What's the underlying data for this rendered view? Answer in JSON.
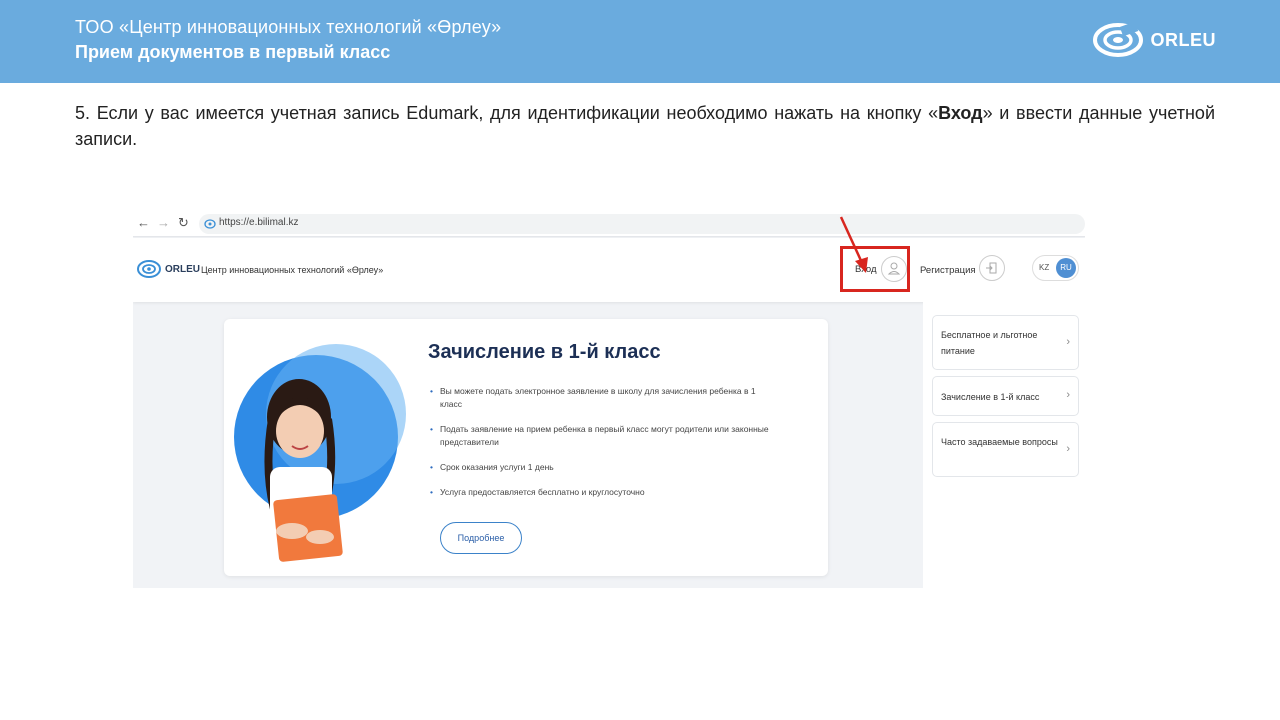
{
  "slide": {
    "org_title": "ТОО «Центр инновационных технологий «Өрлеу»",
    "topic": "Прием документов в первый класс",
    "brand": "ORLEU"
  },
  "instruction": {
    "bold_part": "5. Если у вас имеется учетная запись Edumark,",
    "text_part1": " для идентификации необходимо нажать на кнопку «",
    "button_name": "Вход",
    "text_part2": "» и ввести данные учетной записи."
  },
  "browser": {
    "url": "https://e.bilimal.kz"
  },
  "site": {
    "logo_text": "ORLEU",
    "title": "Центр инновационных технологий «Өрлеу»",
    "login_label": "Вход",
    "register_label": "Регистрация",
    "lang_kz": "KZ",
    "lang_ru": "RU"
  },
  "card": {
    "title": "Зачисление в 1-й класс",
    "bullets": [
      "Вы можете подать электронное заявление в школу для зачисления ребенка в 1 класс",
      "Подать заявление на прием ребенка в первый класс могут родители или законные представители",
      "Срок оказания услуги 1 день",
      "Услуга предоставляется бесплатно и круглосуточно"
    ],
    "more_label": "Подробнее"
  },
  "sidebar": {
    "items": [
      {
        "label": "Бесплатное и льготное питание"
      },
      {
        "label": "Зачисление в 1-й класс"
      },
      {
        "label": "Часто задаваемые вопросы"
      }
    ]
  },
  "colors": {
    "header_band": "#6aabde",
    "highlight_box": "#d8261f",
    "accent": "#4f8fd3"
  }
}
